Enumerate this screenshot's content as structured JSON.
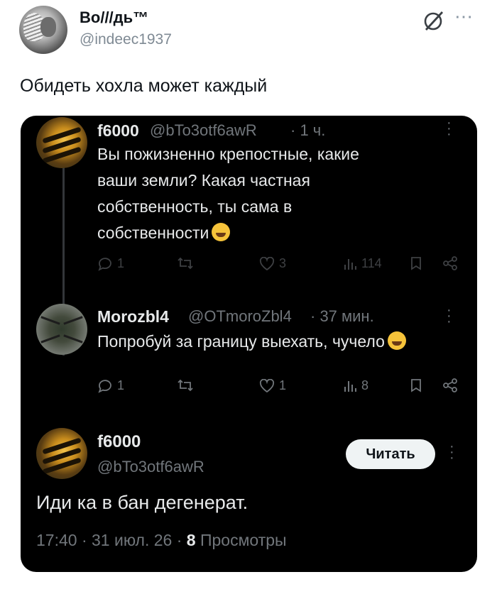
{
  "author": {
    "name": "Bo///дь™",
    "handle": "@indeec1937"
  },
  "post": {
    "text": "Обидеть хохла может каждый"
  },
  "embedded_thread": [
    {
      "name": "f6000",
      "handle": "@bTo3otf6awR",
      "time": "· 1 ч.",
      "text_lines": [
        "Вы пожизненно крепостные, какие",
        "ваши земли? Какая частная",
        "собственность, ты сама в",
        "собственности"
      ],
      "stats": {
        "replies": "1",
        "reposts": "",
        "likes": "3",
        "views": "114"
      }
    },
    {
      "name": "Morozbl4",
      "handle": "@OTmoroZbl4",
      "time": "· 37 мин.",
      "text_lines": [
        "Попробуй за границу выехать, чучело"
      ],
      "stats": {
        "replies": "1",
        "reposts": "",
        "likes": "1",
        "views": "8"
      }
    }
  ],
  "main_tweet": {
    "name": "f6000",
    "handle": "@bTo3otf6awR",
    "follow_label": "Читать",
    "text": "Иди ка в бан дегенерат.",
    "time": "17:40 · 31 июл. 26 ·",
    "views_count": "8",
    "views_label": "Просмотры"
  },
  "colors": {
    "accent_bg": "#000000",
    "muted": "#71767b",
    "text_light": "#e7e9ea"
  }
}
